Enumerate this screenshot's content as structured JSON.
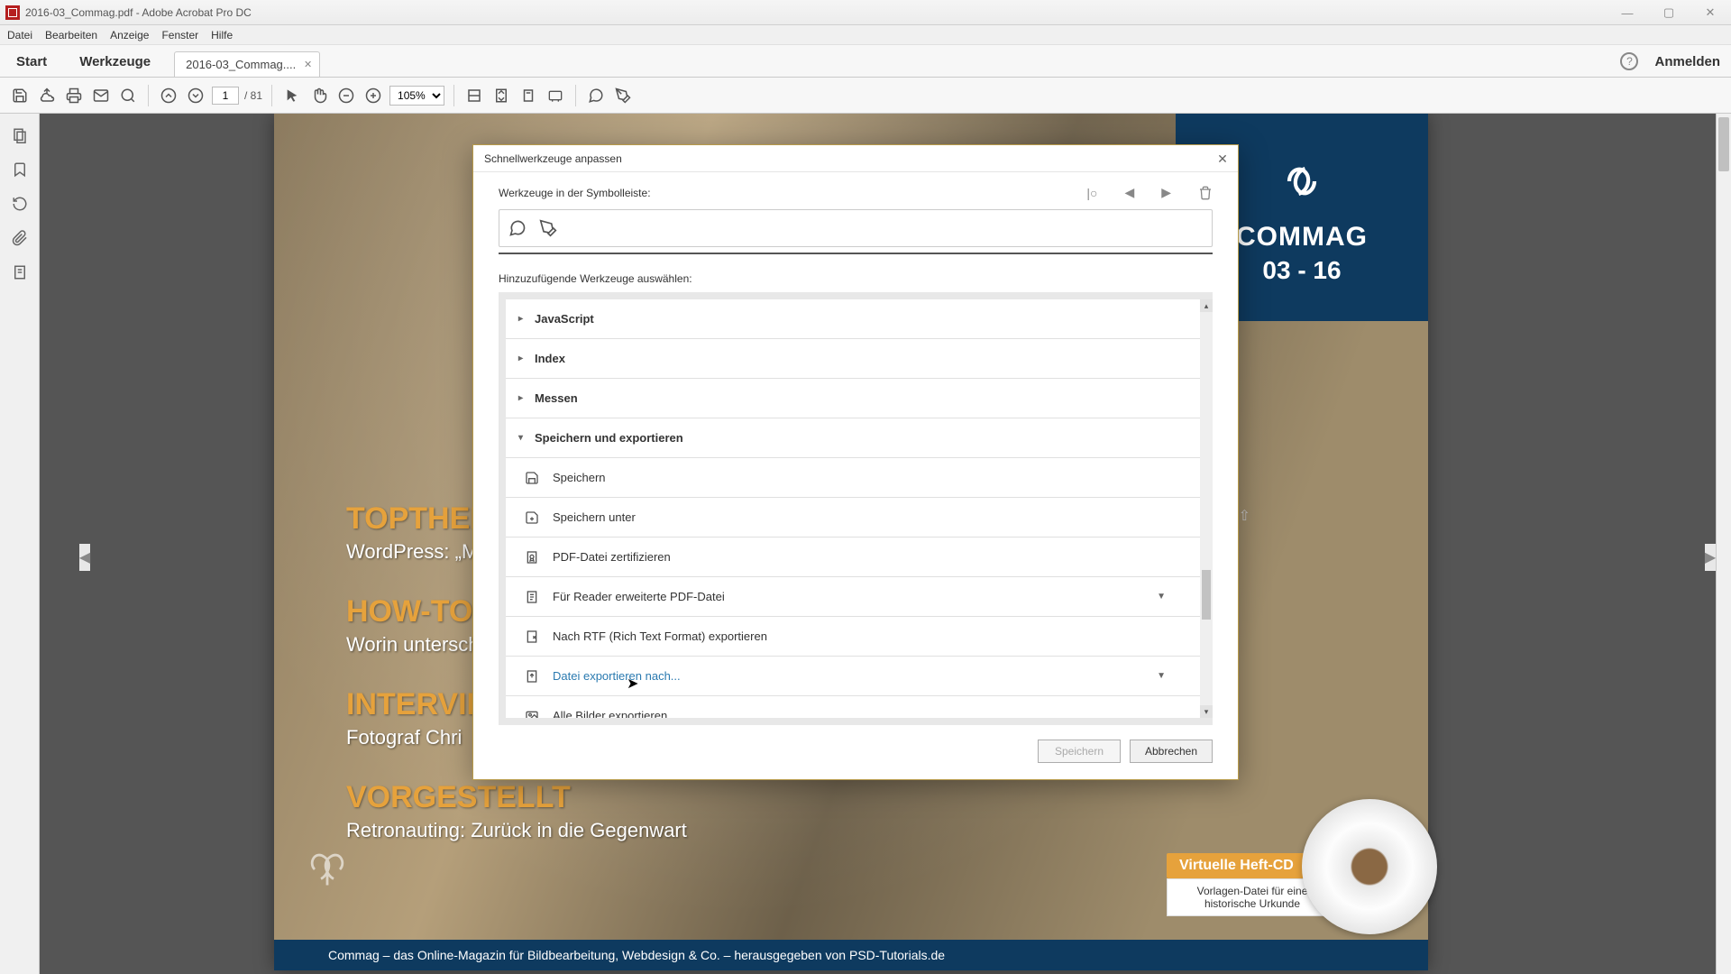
{
  "titlebar": {
    "text": "2016-03_Commag.pdf - Adobe Acrobat Pro DC"
  },
  "menubar": [
    "Datei",
    "Bearbeiten",
    "Anzeige",
    "Fenster",
    "Hilfe"
  ],
  "tabs": {
    "start": "Start",
    "tools": "Werkzeuge",
    "doc": "2016-03_Commag...."
  },
  "right_header": {
    "signin": "Anmelden"
  },
  "toolbar": {
    "page_current": "1",
    "page_total": "81",
    "zoom": "105%"
  },
  "doc": {
    "brand_title": "COMMAG",
    "brand_issue": "03 - 16",
    "headlines": [
      {
        "cat": "TOPTHEMA",
        "sub": "WordPress: „M"
      },
      {
        "cat": "HOW-TO",
        "sub": "Worin untersch"
      },
      {
        "cat": "INTERVIE",
        "sub": "Fotograf Chri"
      },
      {
        "cat": "VORGESTELLT",
        "sub": "Retronauting: Zurück in die Gegenwart"
      }
    ],
    "cd": {
      "label": "Virtuelle Heft-CD",
      "desc": "Vorlagen-Datei für eine historische Urkunde"
    },
    "footer": "Commag – das Online-Magazin für Bildbearbeitung, Webdesign & Co. – herausgegeben von PSD-Tutorials.de"
  },
  "dialog": {
    "title": "Schnellwerkzeuge anpassen",
    "label_toolbar": "Werkzeuge in der Symbolleiste:",
    "label_add": "Hinzuzufügende Werkzeuge auswählen:",
    "categories": [
      {
        "type": "head",
        "label": "JavaScript",
        "expanded": false
      },
      {
        "type": "head",
        "label": "Index",
        "expanded": false
      },
      {
        "type": "head",
        "label": "Messen",
        "expanded": false
      },
      {
        "type": "head",
        "label": "Speichern und exportieren",
        "expanded": true
      },
      {
        "type": "child",
        "label": "Speichern",
        "icon": "save"
      },
      {
        "type": "child",
        "label": "Speichern unter",
        "icon": "saveas"
      },
      {
        "type": "child",
        "label": "PDF-Datei zertifizieren",
        "icon": "cert"
      },
      {
        "type": "child",
        "label": "Für Reader erweiterte PDF-Datei",
        "icon": "reader",
        "dropdown": true
      },
      {
        "type": "child",
        "label": "Nach RTF (Rich Text Format) exportieren",
        "icon": "rtf"
      },
      {
        "type": "child",
        "label": "Datei exportieren nach...",
        "icon": "export",
        "dropdown": true,
        "hover": true
      },
      {
        "type": "child",
        "label": "Alle Bilder exportieren",
        "icon": "images"
      }
    ],
    "btn_save": "Speichern",
    "btn_cancel": "Abbrechen"
  }
}
